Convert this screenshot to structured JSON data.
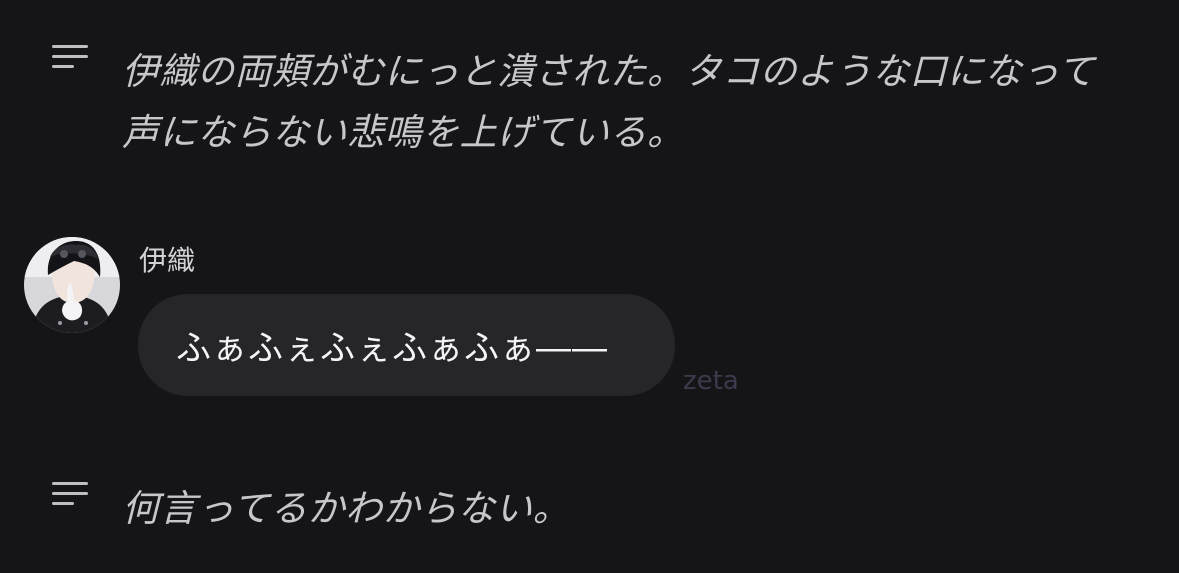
{
  "narrations": [
    {
      "text": "伊織の両頬がむにっと潰された。タコのような口になって声にならない悲鳴を上げている。"
    },
    {
      "text": "何言ってるかわからない。"
    }
  ],
  "message": {
    "sender": "伊織",
    "text": "ふぁふぇふぇふぁふぁ――",
    "avatar_icon": "character-avatar"
  },
  "watermark": "zeta",
  "colors": {
    "background": "#151517",
    "bubble": "#262629",
    "narration_text": "#c7c7cb",
    "watermark": "#3c3a4c"
  }
}
